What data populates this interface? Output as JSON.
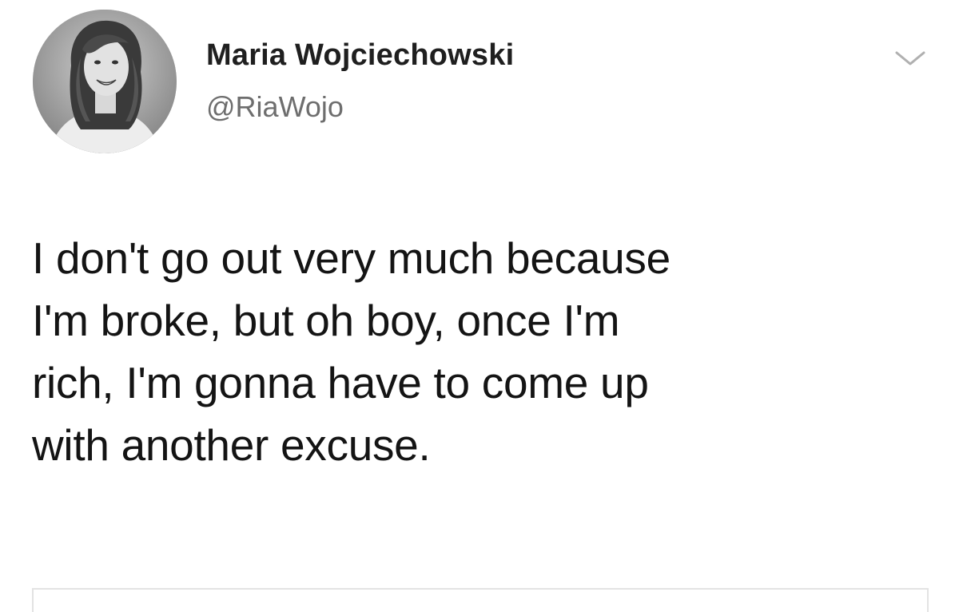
{
  "tweet": {
    "author": {
      "display_name": "Maria Wojciechowski",
      "handle": "@RiaWojo",
      "avatar_icon": "avatar-photo"
    },
    "menu_icon": "chevron-down-icon",
    "text": "I don't go out very much because\nI'm broke, but oh boy, once I'm\nrich, I'm gonna have to come up\nwith another excuse."
  },
  "colors": {
    "background": "#ffffff",
    "name": "#1f1f1f",
    "handle": "#6e6e6e",
    "body_text": "#141414",
    "divider": "#e3e3e3"
  }
}
